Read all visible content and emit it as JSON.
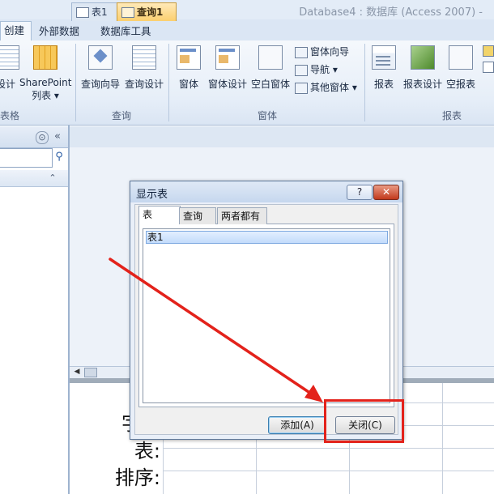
{
  "window": {
    "title": "Database4 : 数据库 (Access 2007) -"
  },
  "ribbon": {
    "tabs": [
      {
        "label": "创建",
        "active": true
      },
      {
        "label": "外部数据",
        "active": false
      },
      {
        "label": "数据库工具",
        "active": false
      }
    ],
    "groups": {
      "tables": {
        "label": "表格",
        "buttons": [
          {
            "label": "设计",
            "icon": "table-design-icon"
          },
          {
            "label": "SharePoint\n列表 ▾",
            "line1": "SharePoint",
            "line2": "列表 ▾",
            "icon": "sharepoint-list-icon"
          }
        ]
      },
      "queries": {
        "label": "查询",
        "buttons": [
          {
            "label": "查询向导",
            "icon": "query-wizard-icon"
          },
          {
            "label": "查询设计",
            "icon": "query-design-icon"
          }
        ]
      },
      "forms": {
        "label": "窗体",
        "buttons": [
          {
            "label": "窗体",
            "icon": "form-icon"
          },
          {
            "label": "窗体设计",
            "icon": "form-design-icon"
          },
          {
            "label": "空白窗体",
            "icon": "blank-form-icon"
          }
        ],
        "small_buttons": [
          {
            "label": "窗体向导",
            "icon": "form-wizard-icon"
          },
          {
            "label": "导航 ▾",
            "icon": "navigation-icon"
          },
          {
            "label": "其他窗体 ▾",
            "icon": "more-forms-icon"
          }
        ]
      },
      "reports": {
        "label": "报表",
        "buttons": [
          {
            "label": "报表",
            "icon": "report-icon"
          },
          {
            "label": "报表设计",
            "icon": "report-design-icon"
          },
          {
            "label": "空报表",
            "icon": "blank-report-icon"
          }
        ]
      }
    }
  },
  "nav_pane": {
    "chevron": "⊙",
    "collapse": "«",
    "search_icon": "⚲",
    "section_toggle": "⌃"
  },
  "document_tabs": [
    {
      "label": "表1",
      "active": false
    },
    {
      "label": "查询1",
      "active": true
    }
  ],
  "query_grid": {
    "row_labels": [
      "字段:",
      "表:",
      "排序:"
    ],
    "row_label_visible": [
      "字段",
      "表:",
      "排序:"
    ]
  },
  "dialog": {
    "title": "显示表",
    "help": "?",
    "close": "✕",
    "tabs": [
      "表",
      "查询",
      "两者都有"
    ],
    "list_items": [
      "表1"
    ],
    "buttons": {
      "add": "添加(A)",
      "close": "关闭(C)"
    }
  },
  "annotation": {
    "arrow_color": "#e3221b",
    "highlight_color": "#e3221b"
  },
  "colors": {
    "ribbon_bg": "#e6eef8",
    "active_doc_tab": "#fbcf6f",
    "selection": "#c3dcfb"
  }
}
